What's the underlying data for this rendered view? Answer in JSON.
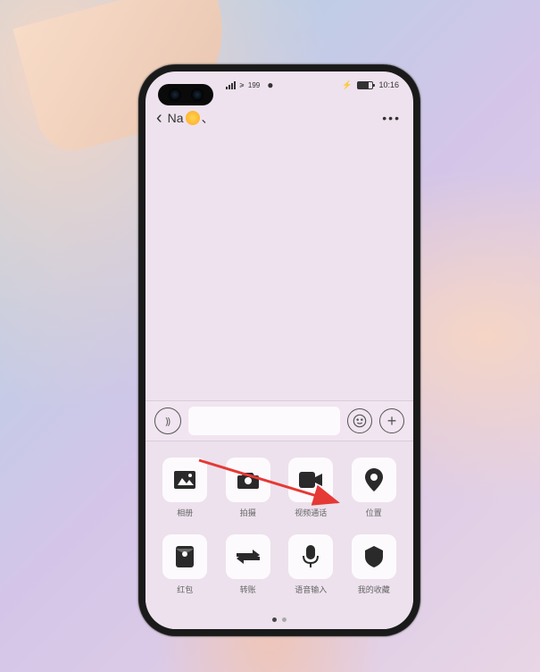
{
  "status": {
    "signal_text": "199",
    "battery_icon": "⚡",
    "time": "10:16"
  },
  "header": {
    "contact_name": "Na",
    "contact_suffix": "、"
  },
  "attach": {
    "items": [
      {
        "label": "相册",
        "name": "album"
      },
      {
        "label": "拍摄",
        "name": "camera"
      },
      {
        "label": "视频通话",
        "name": "video-call"
      },
      {
        "label": "位置",
        "name": "location"
      },
      {
        "label": "红包",
        "name": "red-packet"
      },
      {
        "label": "转账",
        "name": "transfer"
      },
      {
        "label": "语音输入",
        "name": "voice-input"
      },
      {
        "label": "我的收藏",
        "name": "favorites"
      }
    ]
  }
}
